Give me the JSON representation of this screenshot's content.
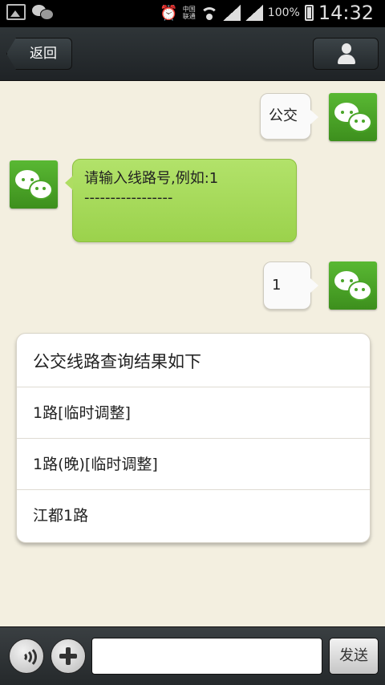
{
  "status_bar": {
    "carrier_line1": "中国",
    "carrier_line2": "联通",
    "battery_pct": "100%",
    "time": "14:32",
    "alarm_icon": "alarm-clock-icon"
  },
  "header": {
    "back_label": "返回",
    "profile_icon": "person-icon"
  },
  "messages": [
    {
      "from": "me",
      "text": "公交"
    },
    {
      "from": "bot",
      "line1": "请输入线路号,例如:1",
      "line2": "-----------------"
    },
    {
      "from": "me",
      "text": "1"
    }
  ],
  "result_card": {
    "title": "公交线路查询结果如下",
    "items": [
      "1路[临时调整]",
      "1路(晚)[临时调整]",
      "江都1路"
    ]
  },
  "bottom_bar": {
    "input_value": "",
    "send_label": "发送"
  },
  "colors": {
    "chat_background": "#f3efe0",
    "green_bubble": "#a6d957",
    "avatar_green": "#4aa528"
  }
}
